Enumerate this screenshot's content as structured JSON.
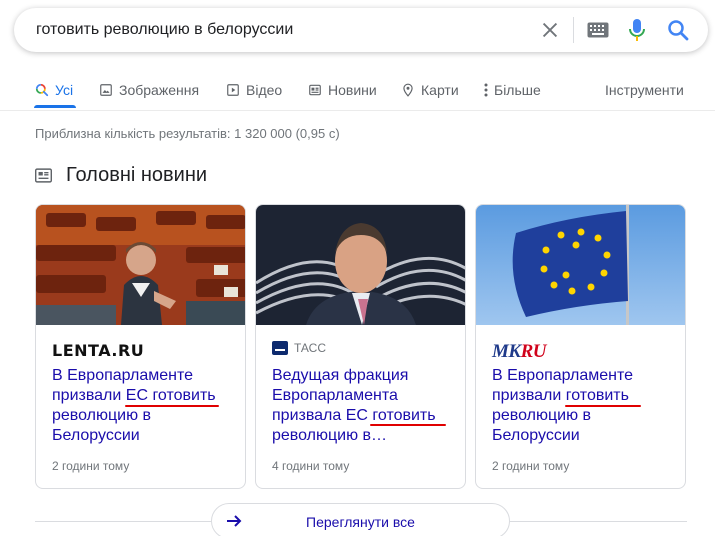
{
  "search": {
    "query": "готовить революцию в белоруссии"
  },
  "tabs": [
    {
      "label": "Усі"
    },
    {
      "label": "Зображення"
    },
    {
      "label": "Відео"
    },
    {
      "label": "Новини"
    },
    {
      "label": "Карти"
    },
    {
      "label": "Більше"
    }
  ],
  "tools_label": "Інструменти",
  "result_stats": "Приблизна кількість результатів: 1 320 000 (0,95 с)",
  "top_stories": {
    "title": "Головні новини",
    "cards": [
      {
        "source": "LENTA.RU",
        "headline": "В Европарламенте призвали ЕС готовить революцию в Белоруссии",
        "time": "2 години тому"
      },
      {
        "source": "ТАСС",
        "headline": "Ведущая фракция Европарламента призвала ЕС готовить революцию в…",
        "time": "4 години тому"
      },
      {
        "source_logo": {
          "mk": "MK",
          "ru": "RU"
        },
        "headline": "В Европарламенте призвали готовить революцию в Белоруссии",
        "time": "2 години тому"
      }
    ],
    "see_all": "Переглянути все"
  },
  "colors": {
    "accent": "#1a73e8",
    "link": "#1a0dab",
    "annotation": "#e00000"
  }
}
